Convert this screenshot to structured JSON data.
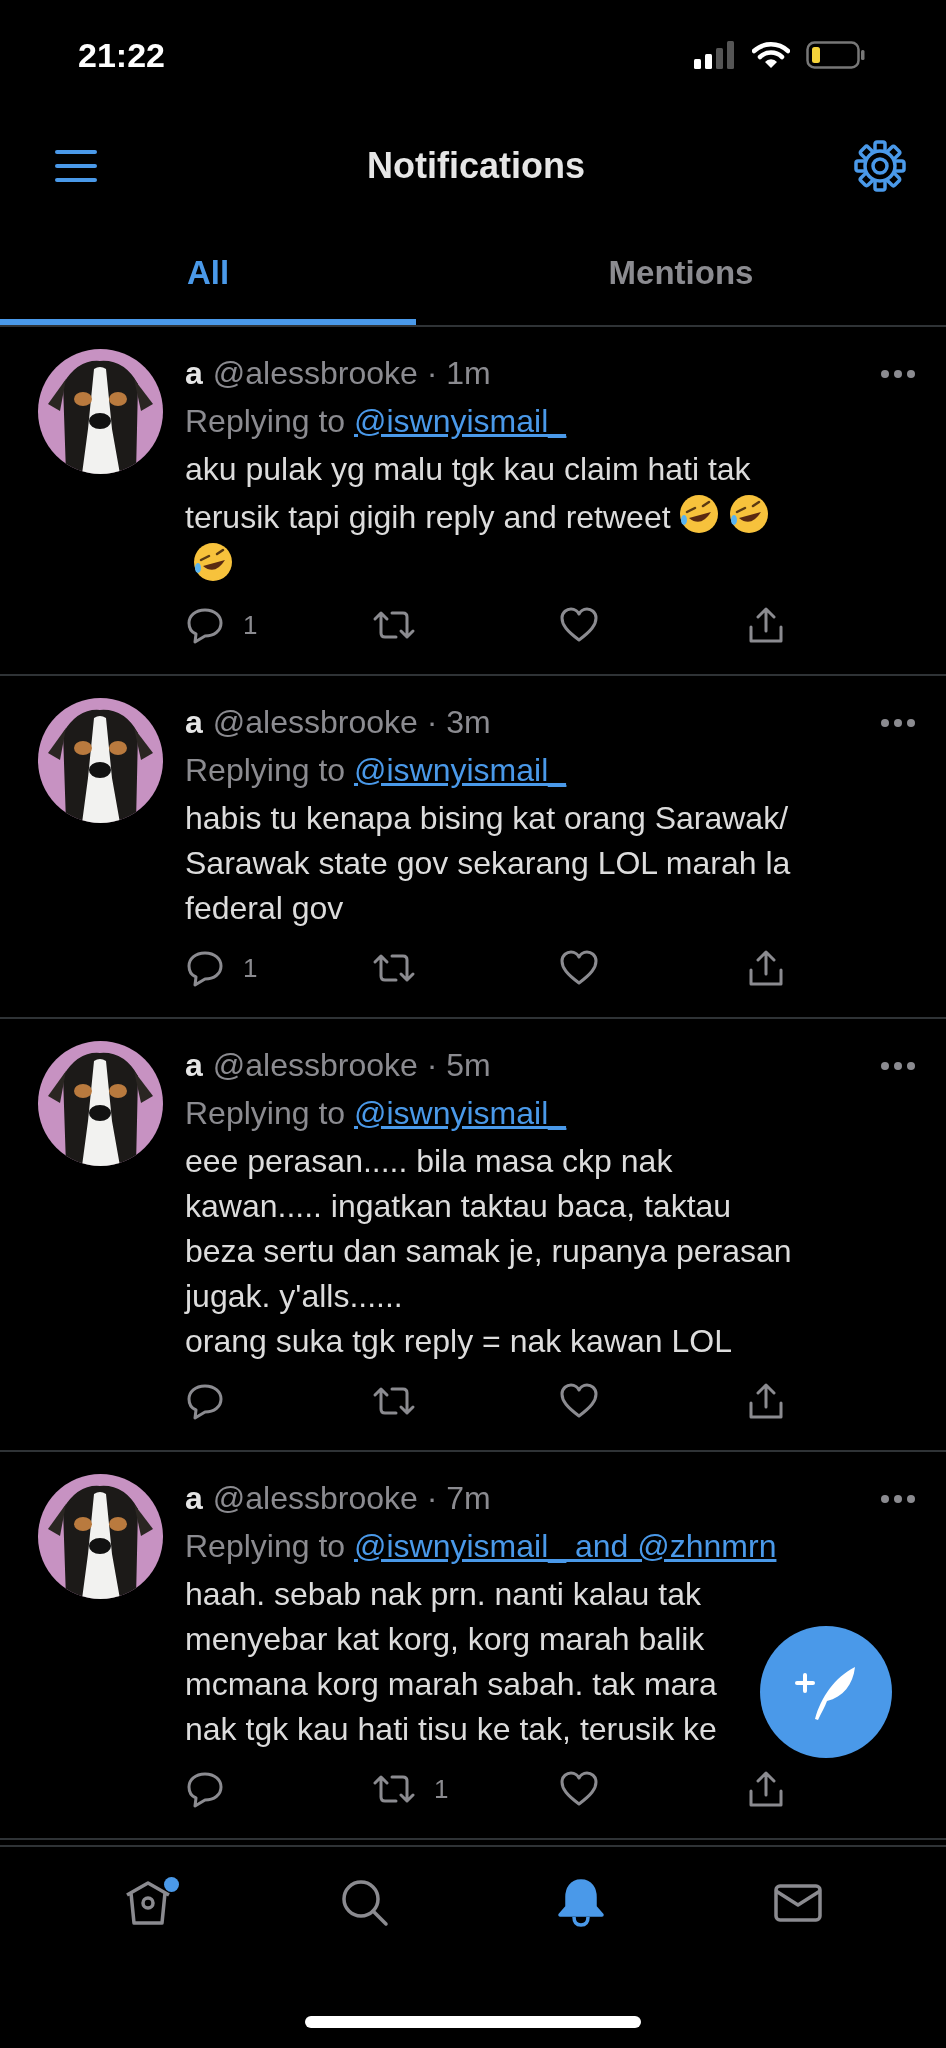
{
  "status_bar": {
    "time": "21:22"
  },
  "header": {
    "title": "Notifications"
  },
  "tabs": [
    {
      "label": "All",
      "selected": true
    },
    {
      "label": "Mentions",
      "selected": false
    }
  ],
  "tweets": [
    {
      "name": "a",
      "handle_time": "@alessbrooke · 1m",
      "replying_prefix": "Replying to",
      "replying_to": "@iswnyismail_",
      "lines": [
        [
          {
            "kind": "text",
            "text": "aku pulak yg malu tgk kau claim hati tak"
          }
        ],
        [
          {
            "kind": "text",
            "text": "terusik tapi gigih reply and retweet"
          },
          {
            "kind": "emoji"
          },
          {
            "kind": "emoji"
          }
        ],
        [
          {
            "kind": "emoji"
          }
        ]
      ],
      "reply_count": "1"
    },
    {
      "name": "a",
      "handle_time": "@alessbrooke · 3m",
      "replying_prefix": "Replying to",
      "replying_to": "@iswnyismail_",
      "lines": [
        [
          {
            "kind": "text",
            "text": "habis tu kenapa bising kat orang Sarawak/"
          }
        ],
        [
          {
            "kind": "text",
            "text": "Sarawak state gov sekarang LOL marah la"
          }
        ],
        [
          {
            "kind": "text",
            "text": "federal gov"
          }
        ]
      ],
      "reply_count": "1"
    },
    {
      "name": "a",
      "handle_time": "@alessbrooke · 5m",
      "replying_prefix": "Replying to",
      "replying_to": "@iswnyismail_",
      "lines": [
        [
          {
            "kind": "text",
            "text": "eee perasan..... bila masa ckp nak"
          }
        ],
        [
          {
            "kind": "text",
            "text": "kawan..... ingatkan taktau baca, taktau"
          }
        ],
        [
          {
            "kind": "text",
            "text": "beza sertu dan samak je, rupanya perasan"
          }
        ],
        [
          {
            "kind": "text",
            "text": "jugak. y'alls......"
          }
        ],
        [
          {
            "kind": "text",
            "text": "orang suka tgk reply = nak kawan LOL"
          }
        ]
      ]
    },
    {
      "name": "a",
      "handle_time": "@alessbrooke · 7m",
      "replying_prefix": "Replying to",
      "replying_to": "@iswnyismail_ and @zhnmrn",
      "lines": [
        [
          {
            "kind": "text",
            "text": "haah. sebab nak prn. nanti kalau tak"
          }
        ],
        [
          {
            "kind": "text",
            "text": "menyebar kat korg, korg marah balik"
          }
        ],
        [
          {
            "kind": "text",
            "text": "mcmana korg marah sabah. tak mara"
          }
        ],
        [
          {
            "kind": "text",
            "text": "nak tgk kau hati tisu ke tak, terusik ke"
          }
        ]
      ],
      "retweet_count": "1"
    }
  ],
  "nav": [
    {
      "kind": "home",
      "selected": false,
      "has_new": true
    },
    {
      "kind": "search",
      "selected": false
    },
    {
      "kind": "notifications",
      "selected": true
    },
    {
      "kind": "messages",
      "selected": false
    }
  ]
}
